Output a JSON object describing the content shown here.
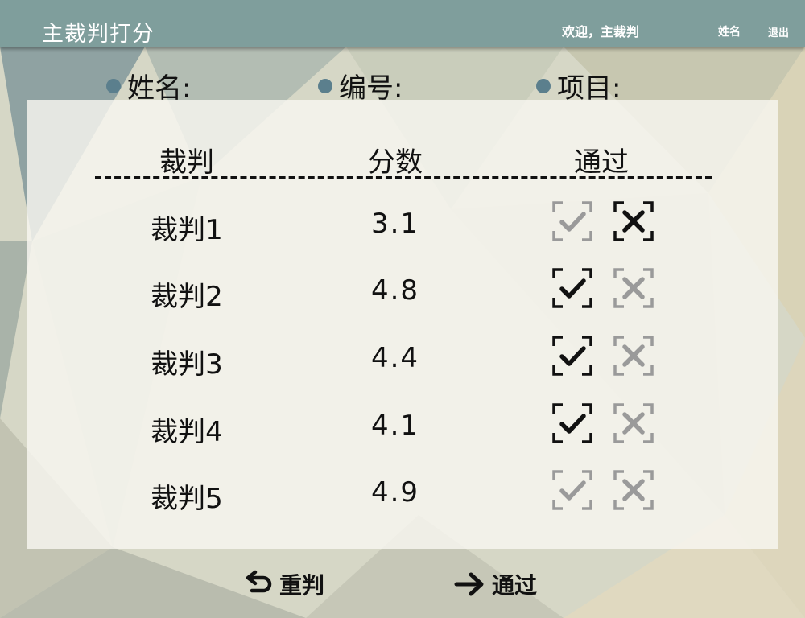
{
  "header": {
    "title": "主裁判打分",
    "welcome": "欢迎，主裁判",
    "name_link": "姓名",
    "logout_link": "退出"
  },
  "info": {
    "name_label": "姓名:",
    "id_label": "编号:",
    "event_label": "项目:"
  },
  "table": {
    "columns": [
      "裁判",
      "分数",
      "通过"
    ],
    "rows": [
      {
        "judge": "裁判1",
        "score": "3.1",
        "check_active": false,
        "cross_active": true
      },
      {
        "judge": "裁判2",
        "score": "4.8",
        "check_active": true,
        "cross_active": false
      },
      {
        "judge": "裁判3",
        "score": "4.4",
        "check_active": true,
        "cross_active": false
      },
      {
        "judge": "裁判4",
        "score": "4.1",
        "check_active": true,
        "cross_active": false
      },
      {
        "judge": "裁判5",
        "score": "4.9",
        "check_active": false,
        "cross_active": false
      }
    ]
  },
  "footer": {
    "rejudge_label": "重判",
    "pass_label": "通过"
  },
  "colors": {
    "topbar": "#7f9e9c",
    "dot": "#5b7f8d",
    "active_icon": "#111111",
    "inactive_icon": "#9a9a9a"
  },
  "icons": {
    "check": "check-icon",
    "cross": "cross-icon",
    "rejudge": "undo-arrow-icon",
    "pass": "right-arrow-icon"
  }
}
